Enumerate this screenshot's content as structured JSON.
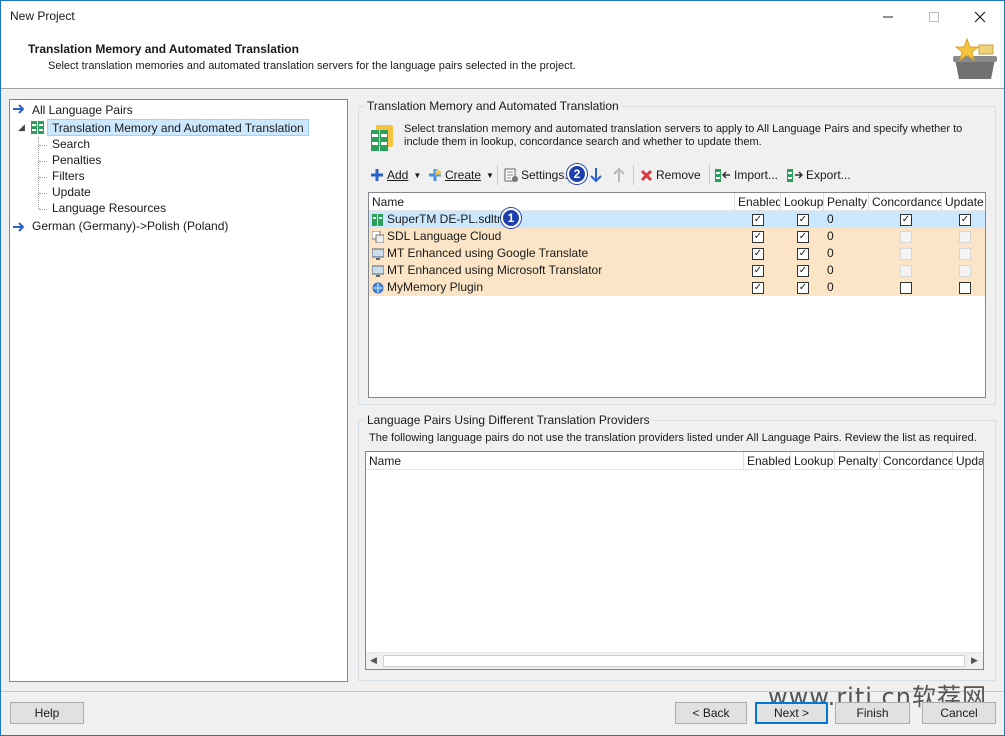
{
  "window": {
    "title": "New Project"
  },
  "header": {
    "title": "Translation Memory and Automated Translation",
    "subtitle": "Select translation memories and automated translation servers for the language pairs selected in the project."
  },
  "tree": {
    "root": "All Language Pairs",
    "selected": "Translation Memory and Automated Translation",
    "children": [
      "Search",
      "Penalties",
      "Filters",
      "Update",
      "Language Resources"
    ],
    "pair": "German (Germany)->Polish (Poland)"
  },
  "tm_group": {
    "title": "Translation Memory and Automated Translation",
    "description": "Select translation memory and automated translation servers to apply to All Language Pairs and specify whether to include them in lookup, concordance search and whether to update them."
  },
  "toolbar": {
    "add": "Add",
    "create": "Create",
    "settings": "Settings...",
    "remove": "Remove",
    "import": "Import...",
    "export": "Export..."
  },
  "columns": [
    "Name",
    "Enabled",
    "Lookup",
    "Penalty",
    "Concordance",
    "Update"
  ],
  "rows": [
    {
      "name": "SuperTM DE-PL.sdltm",
      "penalty": "0",
      "enabled": true,
      "lookup": true,
      "concordance": "checked",
      "update": "checked"
    },
    {
      "name": "SDL Language Cloud",
      "penalty": "0",
      "enabled": true,
      "lookup": true,
      "concordance": "disabled",
      "update": "disabled"
    },
    {
      "name": "MT Enhanced using Google Translate",
      "penalty": "0",
      "enabled": true,
      "lookup": true,
      "concordance": "disabled",
      "update": "disabled"
    },
    {
      "name": "MT Enhanced using Microsoft Translator",
      "penalty": "0",
      "enabled": true,
      "lookup": true,
      "concordance": "disabled",
      "update": "disabled"
    },
    {
      "name": "MyMemory Plugin",
      "penalty": "0",
      "enabled": true,
      "lookup": true,
      "concordance": "unchecked",
      "update": "unchecked"
    }
  ],
  "badges": {
    "one": "1",
    "two": "2"
  },
  "lp_group": {
    "title": "Language Pairs Using Different Translation Providers",
    "description": "The following language pairs do not use the translation providers listed under All Language Pairs. Review the list as required.",
    "columns": [
      "Name",
      "Enabled",
      "Lookup",
      "Penalty",
      "Concordance",
      "Updat"
    ]
  },
  "buttons": {
    "help": "Help",
    "back": "< Back",
    "next": "Next >",
    "finish": "Finish",
    "cancel": "Cancel"
  },
  "watermark": "www.rjtj.cn软荐网",
  "colors": {
    "selected_row": "#cce8ff",
    "provider_row": "#fbe5c6",
    "badge": "#1f3fae",
    "accent": "#0078d7"
  }
}
